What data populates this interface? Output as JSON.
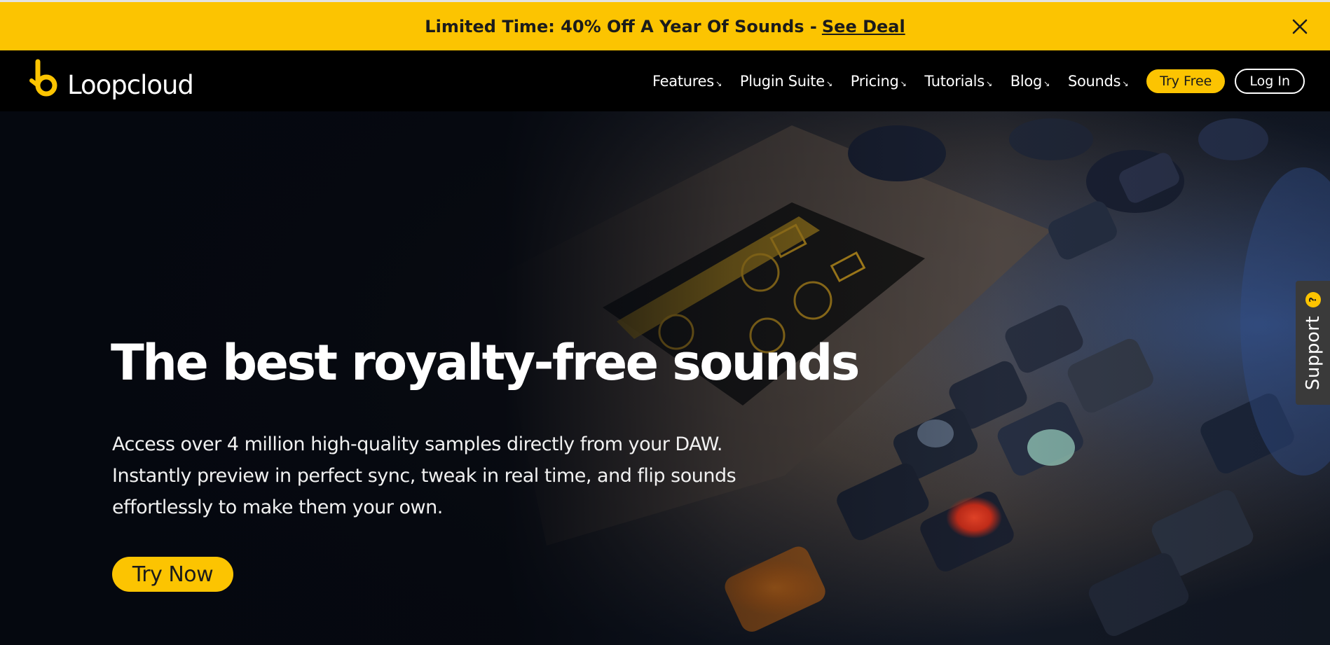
{
  "colors": {
    "accent": "#fcc401",
    "nav_bg": "#000000",
    "hero_bg": "#05080f",
    "support_bg": "#3a3a3a"
  },
  "promo": {
    "text": "Limited Time: 40% Off A Year Of Sounds -",
    "link": "See Deal",
    "close_icon": "close-icon"
  },
  "nav": {
    "logo_icon": "loopcloud-logo-icon",
    "logo_text": "Loopcloud",
    "items": [
      {
        "label": "Features",
        "arrow": "↘"
      },
      {
        "label": "Plugin Suite",
        "arrow": "↘"
      },
      {
        "label": "Pricing",
        "arrow": "↘"
      },
      {
        "label": "Tutorials",
        "arrow": "↘"
      },
      {
        "label": "Blog",
        "arrow": "↘"
      },
      {
        "label": "Sounds",
        "arrow": "↘"
      }
    ],
    "try_free": "Try Free",
    "login": "Log In"
  },
  "hero": {
    "title": "The best royalty-free sounds",
    "description_lines": [
      "Access over 4 million high-quality samples directly from your DAW.",
      "Instantly preview in perfect sync, tweak in real time, and flip sounds",
      "effortlessly to make them your own."
    ],
    "cta": "Try Now"
  },
  "support": {
    "label": "Support",
    "badge": "?"
  }
}
